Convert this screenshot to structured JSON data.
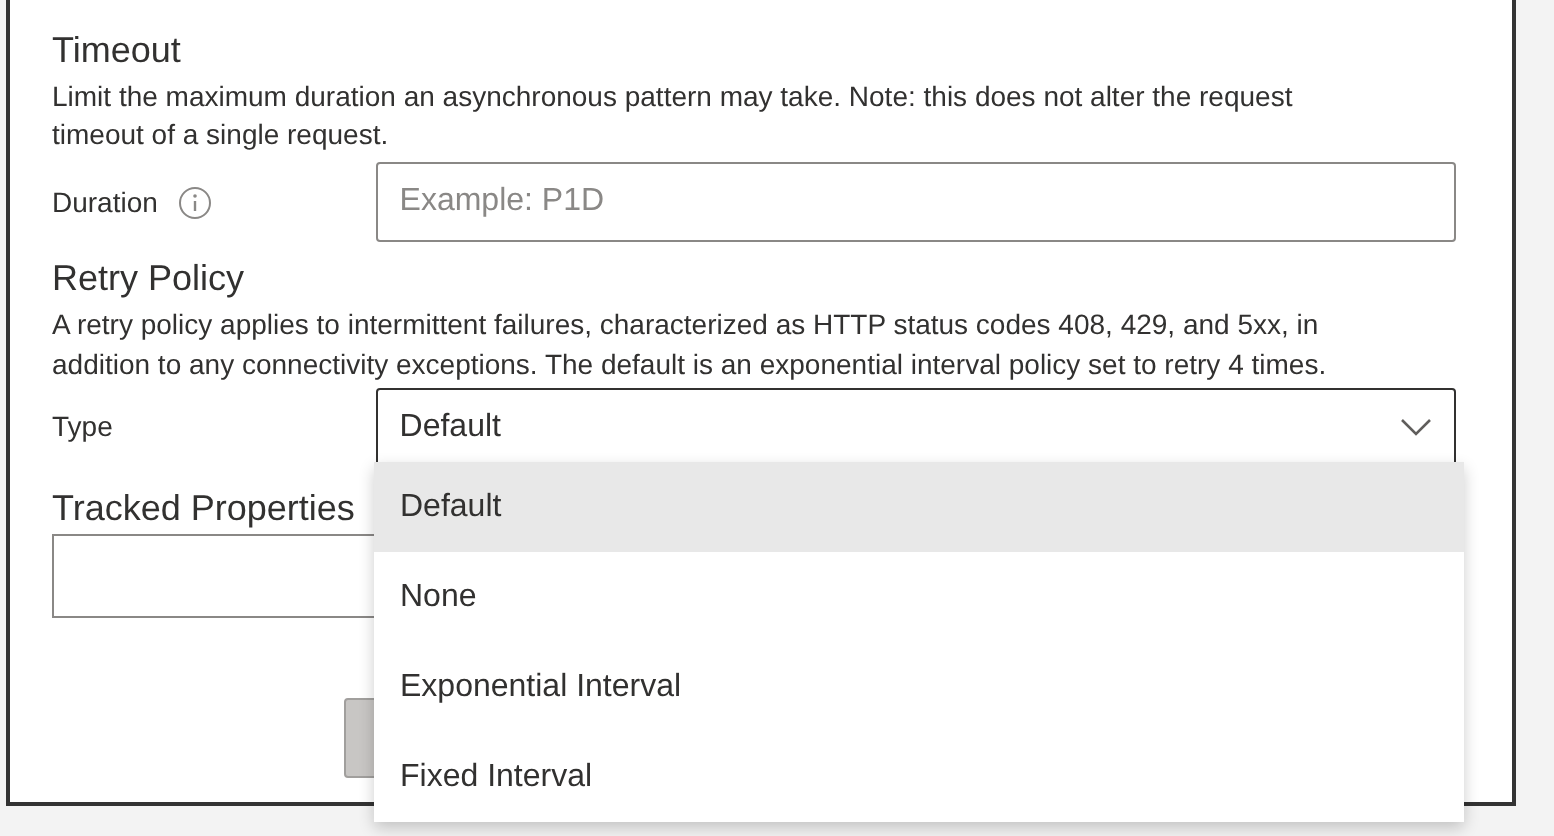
{
  "timeout": {
    "title": "Timeout",
    "description": "Limit the maximum duration an asynchronous pattern may take. Note: this does not alter the request timeout of a single request.",
    "duration": {
      "label": "Duration",
      "placeholder": "Example: P1D"
    }
  },
  "retry_policy": {
    "title": "Retry Policy",
    "description": "A retry policy applies to intermittent failures, characterized as HTTP status codes 408, 429, and 5xx, in addition to any connectivity exceptions. The default is an exponential interval policy set to retry 4 times.",
    "type": {
      "label": "Type",
      "value": "Default",
      "expanded": true,
      "options": [
        {
          "label": "Default",
          "selected": true
        },
        {
          "label": "None",
          "selected": false
        },
        {
          "label": "Exponential Interval",
          "selected": false
        },
        {
          "label": "Fixed Interval",
          "selected": false
        }
      ]
    }
  },
  "tracked_properties": {
    "title": "Tracked Properties"
  }
}
